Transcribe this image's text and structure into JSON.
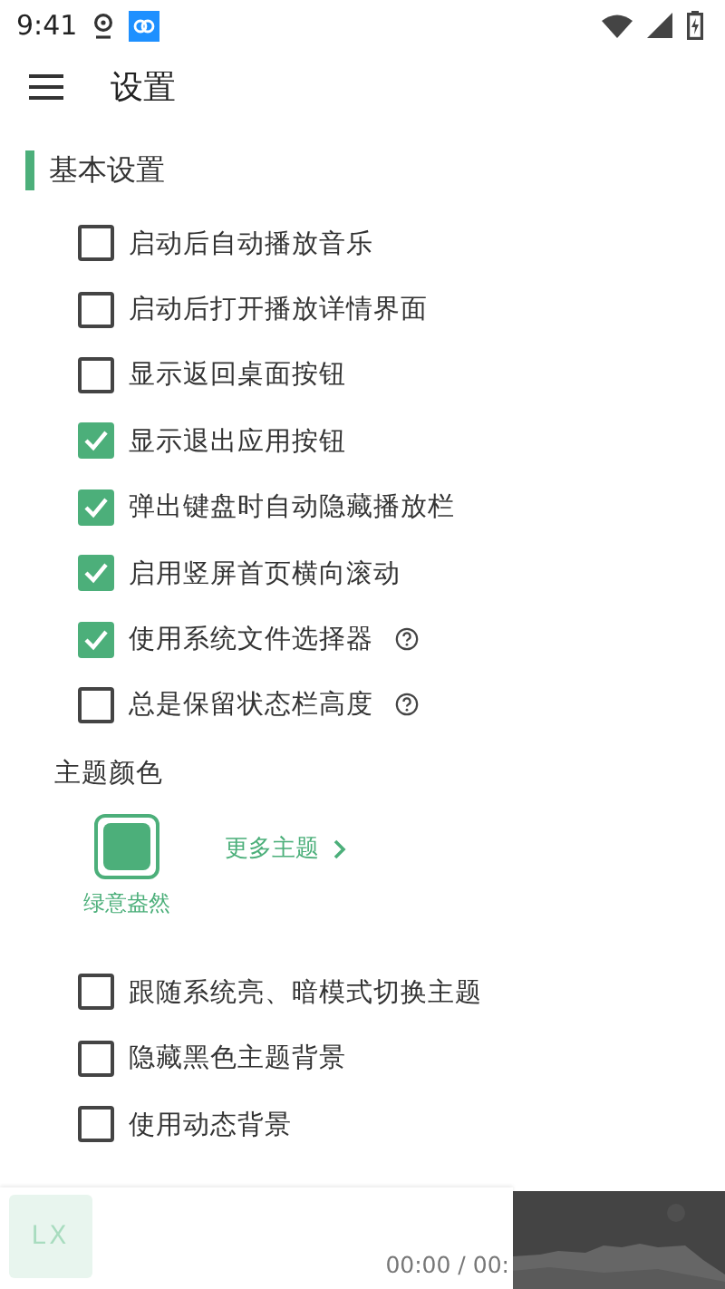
{
  "status_bar": {
    "time": "9:41"
  },
  "header": {
    "title": "设置"
  },
  "section": {
    "title": "基本设置"
  },
  "options": [
    {
      "label": "启动后自动播放音乐",
      "checked": false,
      "help": false
    },
    {
      "label": "启动后打开播放详情界面",
      "checked": false,
      "help": false
    },
    {
      "label": "显示返回桌面按钮",
      "checked": false,
      "help": false
    },
    {
      "label": "显示退出应用按钮",
      "checked": true,
      "help": false
    },
    {
      "label": "弹出键盘时自动隐藏播放栏",
      "checked": true,
      "help": false
    },
    {
      "label": "启用竖屏首页横向滚动",
      "checked": true,
      "help": false
    },
    {
      "label": "使用系统文件选择器",
      "checked": true,
      "help": true
    },
    {
      "label": "总是保留状态栏高度",
      "checked": false,
      "help": true
    }
  ],
  "theme": {
    "title": "主题颜色",
    "themes": [
      {
        "name": "绿意盎然",
        "color": "#4caf7a",
        "selected": true
      }
    ],
    "more": "更多主题"
  },
  "theme_options": [
    {
      "label": "跟随系统亮、暗模式切换主题",
      "checked": false
    },
    {
      "label": "隐藏黑色主题背景",
      "checked": false
    },
    {
      "label": "使用动态背景",
      "checked": false
    }
  ],
  "player": {
    "logo": "LX",
    "time": "00:00 / 00:"
  }
}
